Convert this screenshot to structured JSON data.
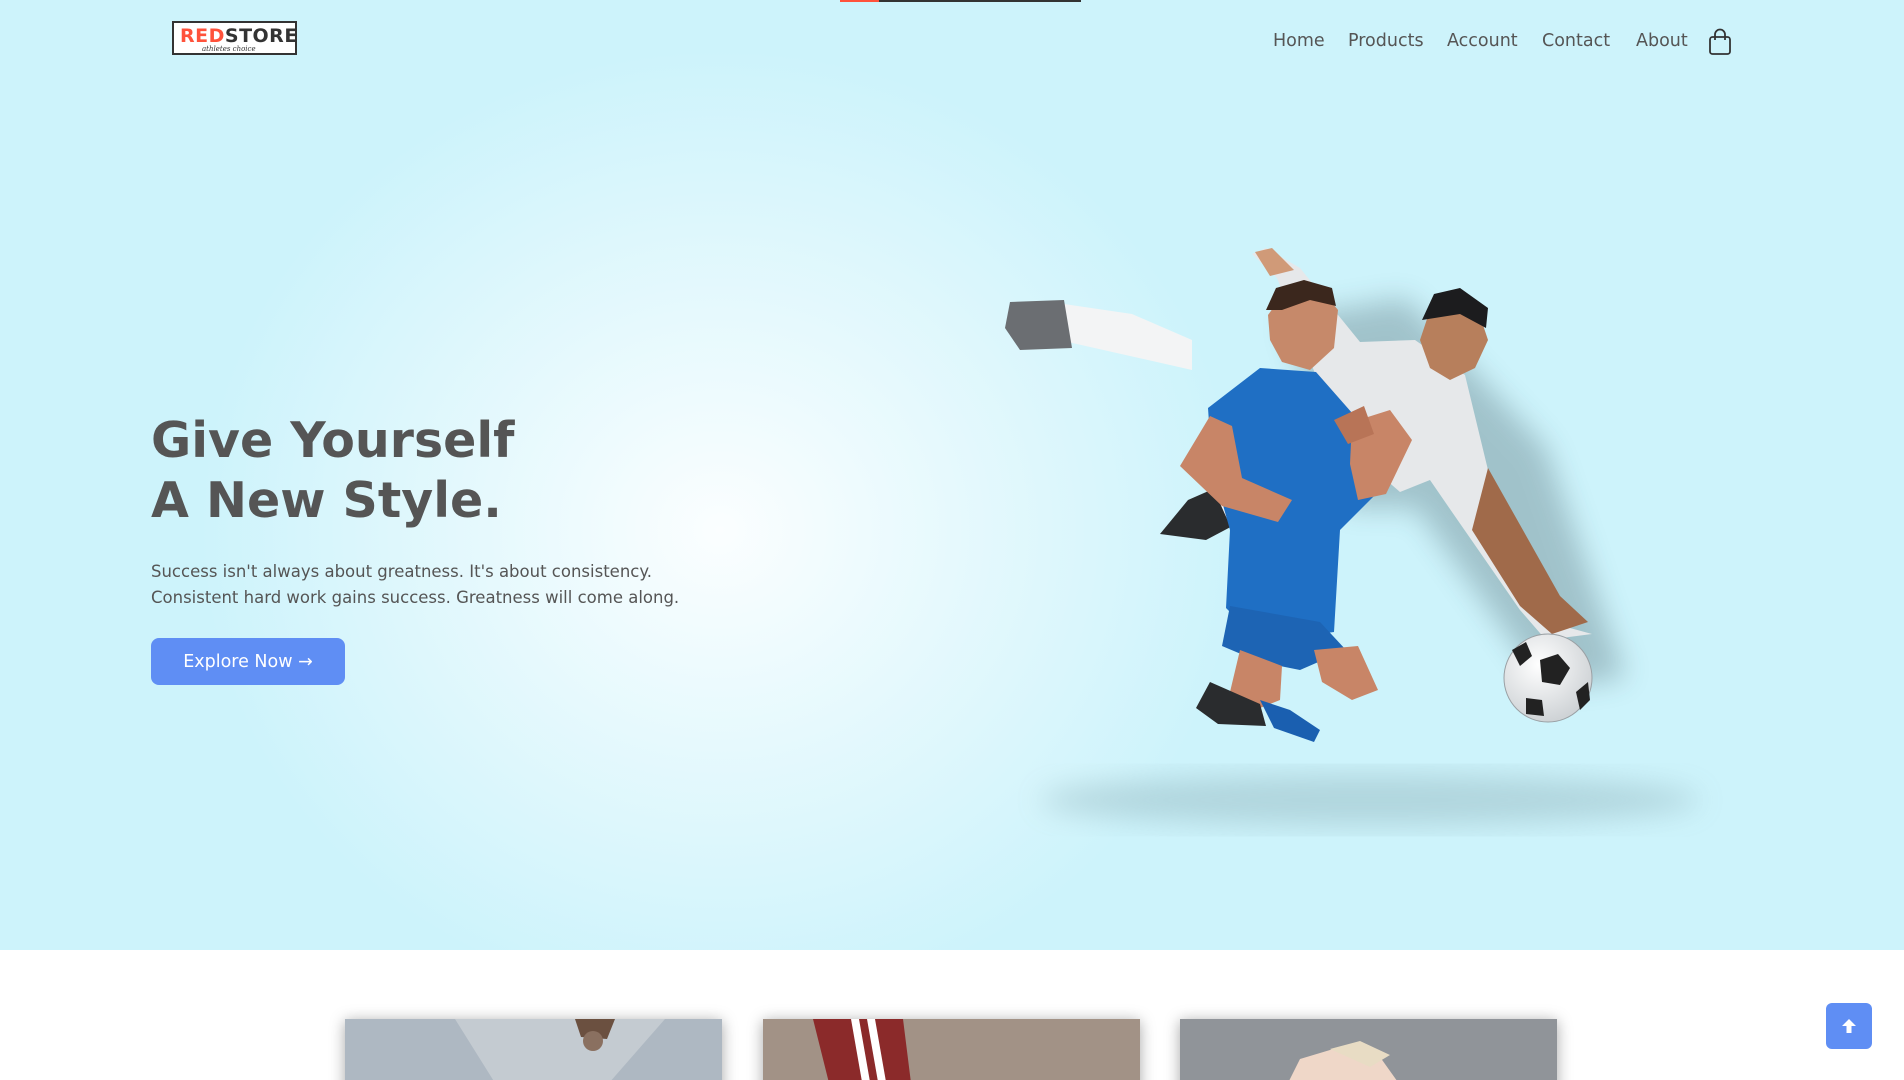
{
  "header": {
    "logo": {
      "brand_red": "RED",
      "brand_dark": "STORE",
      "tagline": "athletes choice"
    },
    "scroll_progress": 0.16,
    "nav": [
      {
        "label": "Home"
      },
      {
        "label": "Products"
      },
      {
        "label": "Account"
      },
      {
        "label": "Contact"
      },
      {
        "label": "About"
      }
    ],
    "cart_icon": "shopping-bag-icon"
  },
  "hero": {
    "title_line1": "Give Yourself",
    "title_line2": "A New Style.",
    "subtitle_line1": "Success isn't always about greatness. It's about consistency.",
    "subtitle_line2": "Consistent hard work gains success. Greatness will come along.",
    "cta_label": "Explore Now →",
    "image": "soccer-players-celebrating"
  },
  "categories": [
    {
      "image": "person-ripped-jeans-wristwatch"
    },
    {
      "image": "red-track-pants-white-stripes"
    },
    {
      "image": "athlete-stretching-blonde"
    }
  ],
  "scroll_top_icon": "arrow-up-icon",
  "colors": {
    "accent": "#ff523b",
    "button": "#5f8ef4",
    "hero_bg": "#cdf3fb",
    "text": "#555555"
  }
}
